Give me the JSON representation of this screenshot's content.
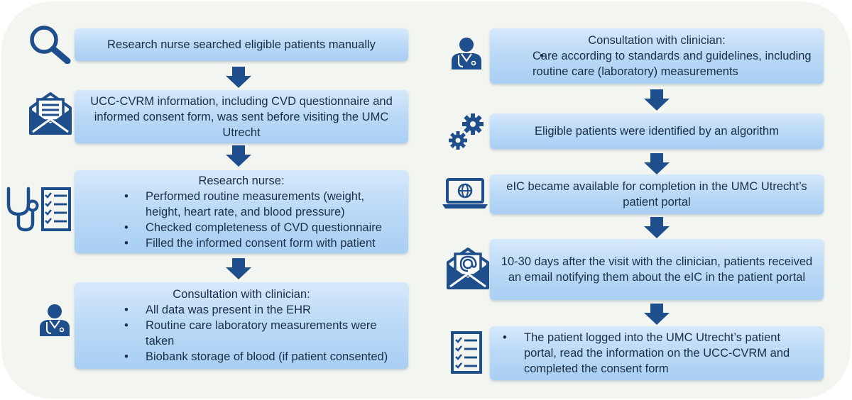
{
  "colors": {
    "navy": "#1f4e8c",
    "box_top": "#d6e9fb",
    "box_bottom": "#a9cff3",
    "background": "#f3f5f1"
  },
  "left": {
    "step1": {
      "text": "Research nurse searched eligible patients manually",
      "icon": "magnifier-icon"
    },
    "step2": {
      "text": "UCC-CVRM information, including CVD questionnaire and informed consent form, was sent before visiting the UMC Utrecht",
      "icon": "mail-document-icon"
    },
    "step3": {
      "heading": "Research nurse:",
      "bullets": [
        "Performed routine measurements (weight, height, heart rate, and blood pressure)",
        "Checked completeness of CVD questionnaire",
        "Filled the informed consent form with patient"
      ],
      "icon": "stethoscope-checklist-icon"
    },
    "step4": {
      "heading": "Consultation with clinician:",
      "bullets": [
        "All data was present in the EHR",
        "Routine care laboratory measurements were taken",
        "Biobank storage of blood (if patient consented)"
      ],
      "icon": "doctor-icon"
    }
  },
  "right": {
    "step1": {
      "heading": "Consultation with clinician:",
      "bullets": [
        "Care according to standards and guidelines, including routine care (laboratory) measurements"
      ],
      "icon": "doctor-icon"
    },
    "step2": {
      "text": "Eligible patients were identified by an algorithm",
      "icon": "gears-icon"
    },
    "step3": {
      "text": "eIC became available for completion in the UMC Utrecht’s patient portal",
      "icon": "laptop-globe-icon"
    },
    "step4": {
      "text": "10-30 days after the visit with the clinician, patients received an email notifying them about the eIC in the patient portal",
      "icon": "email-at-icon"
    },
    "step5": {
      "bullets": [
        "The patient logged into the UMC Utrecht’s patient portal, read the information on the UCC-CVRM and completed the consent form"
      ],
      "icon": "checklist-icon"
    }
  }
}
